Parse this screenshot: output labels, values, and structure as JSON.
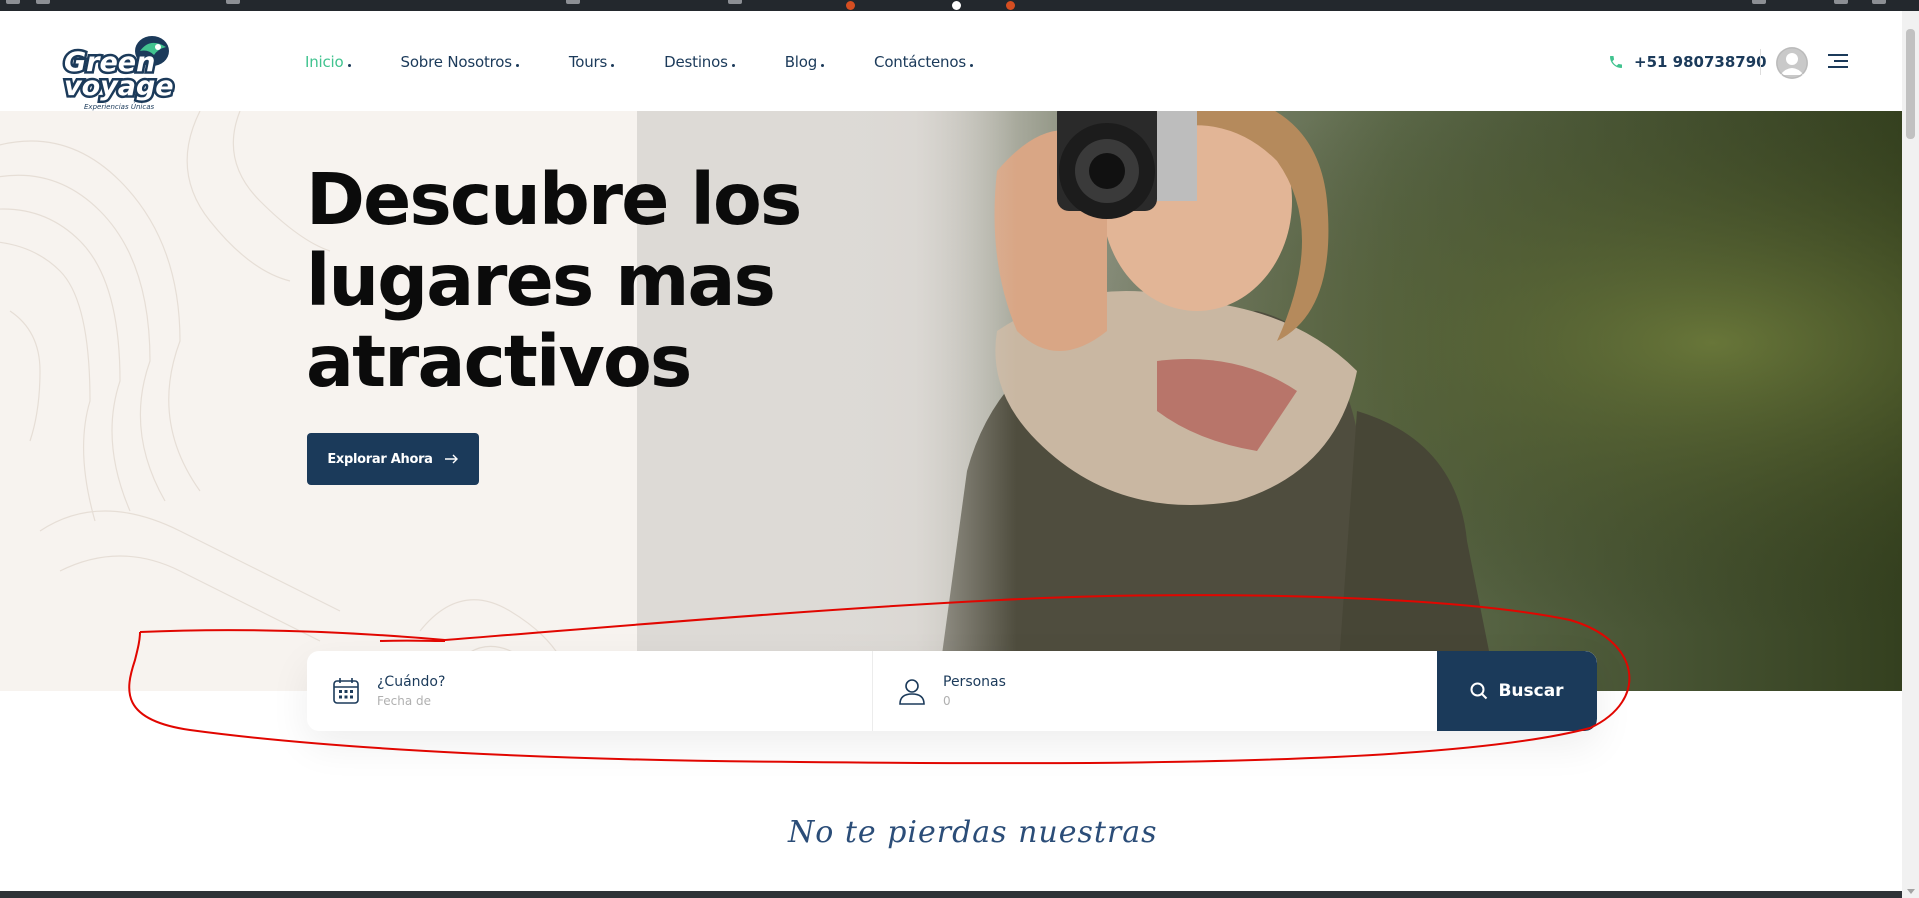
{
  "header": {
    "nav": [
      {
        "label": "Inicio",
        "active": true
      },
      {
        "label": "Sobre Nosotros",
        "active": false
      },
      {
        "label": "Tours",
        "active": false
      },
      {
        "label": "Destinos",
        "active": false
      },
      {
        "label": "Blog",
        "active": false
      },
      {
        "label": "Contáctenos",
        "active": false
      }
    ],
    "phone": "+51 980738790",
    "phone_icon": "phone-icon",
    "avatar_icon": "user-avatar",
    "menu_icon": "hamburger-menu-icon"
  },
  "logo": {
    "text_line1": "Green",
    "text_line2": "voyage",
    "tagline": "Experiencias Únicas"
  },
  "hero": {
    "title": "Descubre los lugares mas atractivos",
    "cta_label": "Explorar Ahora",
    "cta_icon": "arrow-right-icon"
  },
  "search": {
    "date_label": "¿Cuándo?",
    "date_placeholder": "Fecha de",
    "date_icon": "calendar-icon",
    "people_label": "Personas",
    "people_value": "0",
    "people_icon": "user-icon",
    "button_label": "Buscar",
    "button_icon": "search-icon"
  },
  "section": {
    "script_heading": "No te pierdas nuestras"
  },
  "colors": {
    "primary": "#1b3a5a",
    "accent": "#41c38f",
    "hero_bg": "#f7f3ef",
    "annotation": "#e10600"
  }
}
